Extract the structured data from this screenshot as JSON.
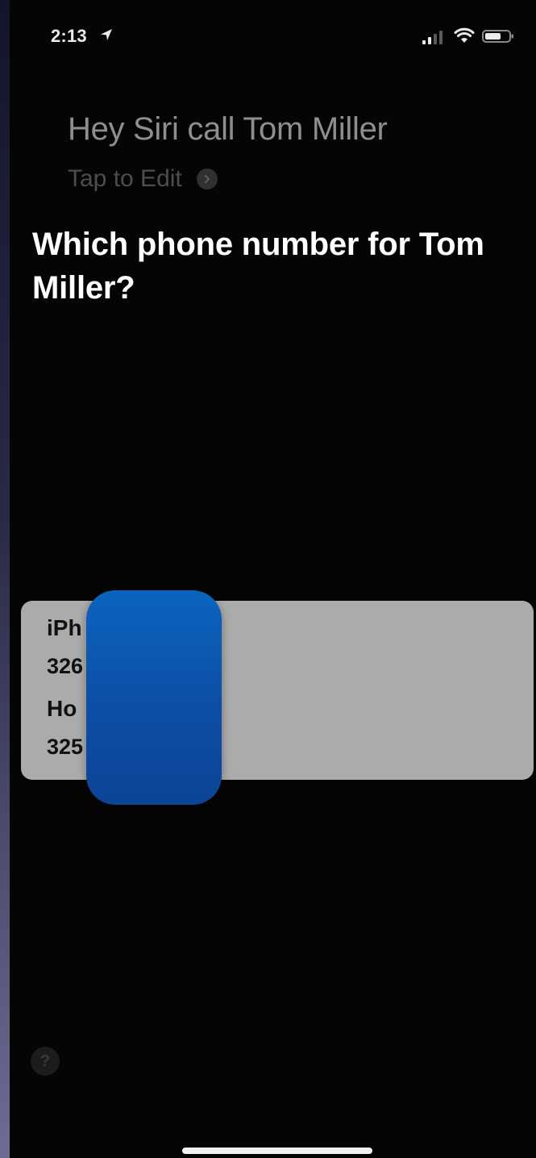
{
  "status_bar": {
    "time": "2:13",
    "location_icon": "location-arrow-icon",
    "signal_icon": "cellular-signal-icon",
    "wifi_icon": "wifi-icon",
    "battery_icon": "battery-icon"
  },
  "siri": {
    "spoken_query": "Hey Siri call Tom Miller",
    "tap_to_edit": "Tap to Edit",
    "question": "Which phone number for Tom Miller?"
  },
  "phone_options": [
    {
      "label": "iPh",
      "number": "326"
    },
    {
      "label": "Ho",
      "number": "325"
    }
  ],
  "help": {
    "symbol": "?"
  },
  "colors": {
    "card_background": "#ababab",
    "redaction_blue": "#0d4ea6",
    "screen_background": "#050505"
  }
}
